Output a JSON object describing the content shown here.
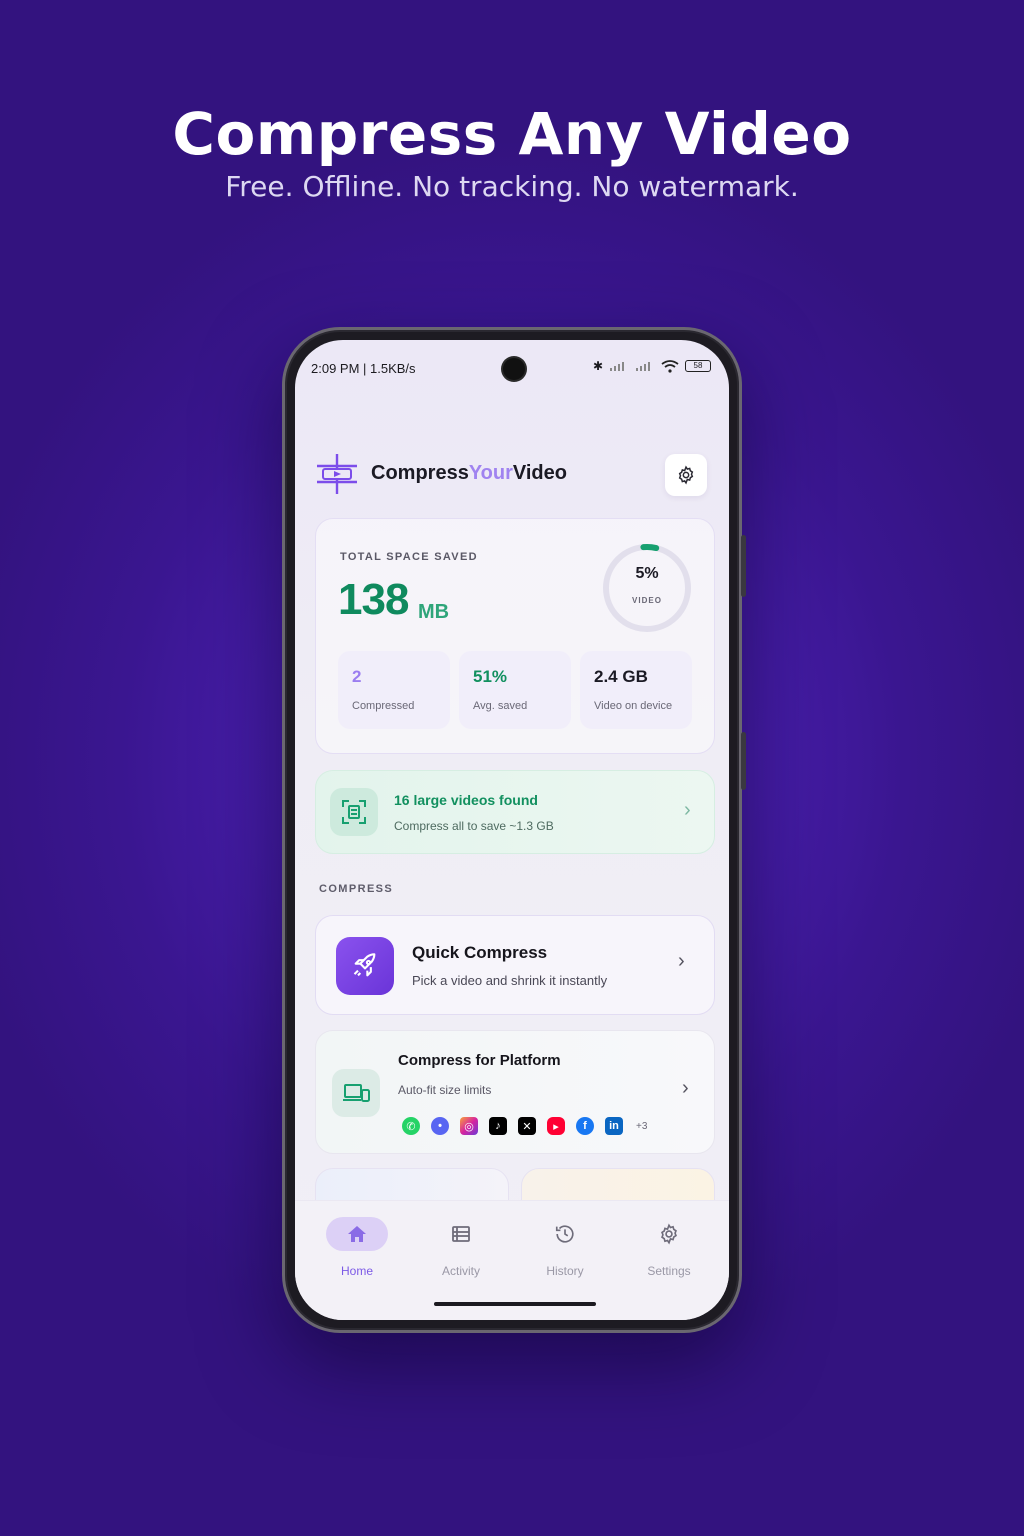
{
  "hero": {
    "title": "Compress Any Video",
    "subtitle": "Free. Offline. No tracking. No watermark."
  },
  "status_bar": {
    "time": "2:09 PM | 1.5KB/s",
    "battery": "58"
  },
  "app": {
    "brand_part1": "Compress",
    "brand_part2": "Your",
    "brand_part3": "Video",
    "settings_icon": "gear-icon"
  },
  "stats": {
    "label": "TOTAL SPACE SAVED",
    "value": "138",
    "unit": "MB",
    "ring_percent": "5%",
    "ring_percent_value": 5,
    "ring_label": "VIDEO",
    "items": [
      {
        "value": "2",
        "label": "Compressed",
        "color": "#9b7df0"
      },
      {
        "value": "51%",
        "label": "Avg. saved",
        "color": "#12905f"
      },
      {
        "value": "2.4 GB",
        "label": "Video on device",
        "color": "#1b1a24"
      }
    ]
  },
  "found": {
    "title": "16 large videos found",
    "subtitle": "Compress all to save ~1.3 GB"
  },
  "section_label": "COMPRESS",
  "quick": {
    "title": "Quick Compress",
    "subtitle": "Pick a video and shrink it instantly"
  },
  "platform": {
    "title": "Compress for Platform",
    "subtitle": "Auto-fit size limits",
    "platforms": [
      "whatsapp",
      "discord",
      "instagram",
      "tiktok",
      "x",
      "youtube-shorts",
      "facebook",
      "linkedin"
    ],
    "more": "+3"
  },
  "nav": {
    "items": [
      {
        "label": "Home",
        "icon": "home-icon",
        "active": true
      },
      {
        "label": "Activity",
        "icon": "list-icon",
        "active": false
      },
      {
        "label": "History",
        "icon": "history-icon",
        "active": false
      },
      {
        "label": "Settings",
        "icon": "gear-icon",
        "active": false
      }
    ]
  },
  "colors": {
    "accent_purple": "#7c4dea",
    "accent_green": "#12905f",
    "background": "#3a1690"
  }
}
